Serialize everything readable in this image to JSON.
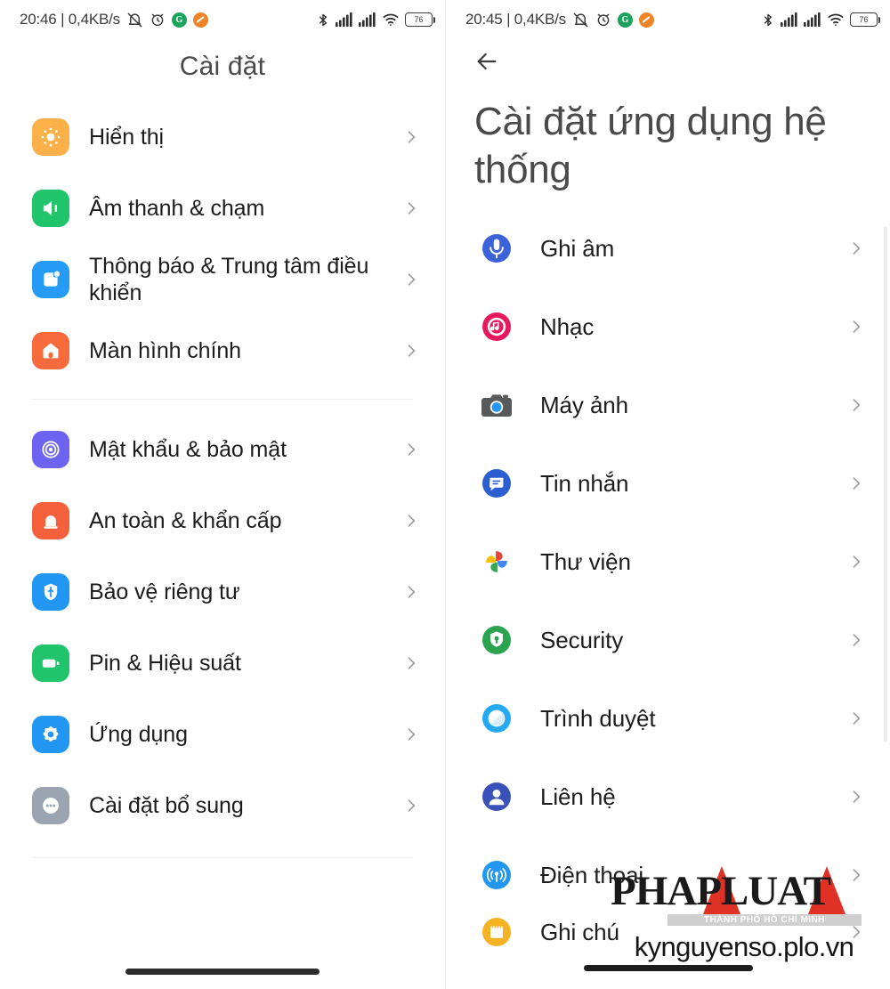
{
  "left_pane": {
    "status_bar": {
      "clock": "20:46 | 0,4KB/s",
      "battery_level": "76",
      "icons": [
        "mute-vibrate-icon",
        "alarm-icon",
        "green-badge-icon",
        "orange-badge-icon",
        "bluetooth-icon",
        "signal-sim1-icon",
        "signal-sim2-icon",
        "wifi-icon",
        "battery-icon"
      ]
    },
    "title": "Cài đặt",
    "groups": [
      {
        "items": [
          {
            "label": "Hiển thị",
            "icon": "display-brightness-icon",
            "color": "#fbb04a"
          },
          {
            "label": "Âm thanh & chạm",
            "icon": "sound-speaker-icon",
            "color": "#1fc46b"
          },
          {
            "label": "Thông báo & Trung tâm điều khiển",
            "icon": "notification-center-icon",
            "color": "#269bf5"
          },
          {
            "label": "Màn hình chính",
            "icon": "home-screen-icon",
            "color": "#f66a3c"
          }
        ]
      },
      {
        "items": [
          {
            "label": "Mật khẩu & bảo mật",
            "icon": "fingerprint-security-icon",
            "color": "#6c63f0"
          },
          {
            "label": "An toàn & khẩn cấp",
            "icon": "emergency-siren-icon",
            "color": "#f4603c"
          },
          {
            "label": "Bảo vệ riêng tư",
            "icon": "privacy-shield-icon",
            "color": "#2196f3"
          },
          {
            "label": "Pin & Hiệu suất",
            "icon": "battery-performance-icon",
            "color": "#1fc46b"
          },
          {
            "label": "Ứng dụng",
            "icon": "apps-gear-icon",
            "color": "#2196f3"
          },
          {
            "label": "Cài đặt bổ sung",
            "icon": "additional-settings-icon",
            "color": "#9aa5b1"
          }
        ]
      }
    ]
  },
  "right_pane": {
    "status_bar": {
      "clock": "20:45 | 0,4KB/s",
      "battery_level": "76"
    },
    "back_label": "back-arrow",
    "title": "Cài đặt ứng dụng hệ thống",
    "items": [
      {
        "label": "Ghi âm",
        "icon": "voice-recorder-icon",
        "color": "#3b62d8"
      },
      {
        "label": "Nhạc",
        "icon": "music-note-icon",
        "color": "#e8185d"
      },
      {
        "label": "Máy ảnh",
        "icon": "camera-icon",
        "color": "#58595b"
      },
      {
        "label": "Tin nhắn",
        "icon": "messages-icon",
        "color": "#2b5fd1"
      },
      {
        "label": "Thư viện",
        "icon": "google-photos-icon",
        "color": "#4285f4"
      },
      {
        "label": "Security",
        "icon": "security-shield-icon",
        "color": "#2aa44f"
      },
      {
        "label": "Trình duyệt",
        "icon": "browser-icon",
        "color": "#26a9f4"
      },
      {
        "label": "Liên hệ",
        "icon": "contacts-person-icon",
        "color": "#3a51ba"
      },
      {
        "label": "Điện thoại",
        "icon": "phone-signal-icon",
        "color": "#2196f3"
      },
      {
        "label": "Ghi chú",
        "icon": "notes-icon",
        "color": "#f5b324"
      }
    ]
  },
  "watermark": {
    "brand": "PHAPLUAT",
    "subtitle": "THÀNH PHỐ HỒ CHÍ MINH",
    "url": "kynguyenso.plo.vn"
  },
  "colors": {
    "accent_blue": "#2196f3",
    "accent_green": "#1fc46b",
    "text_primary": "#1c1c1c",
    "text_secondary": "#4a4a4a",
    "chevron": "#9b9b9b",
    "watermark_red": "#e03127"
  }
}
